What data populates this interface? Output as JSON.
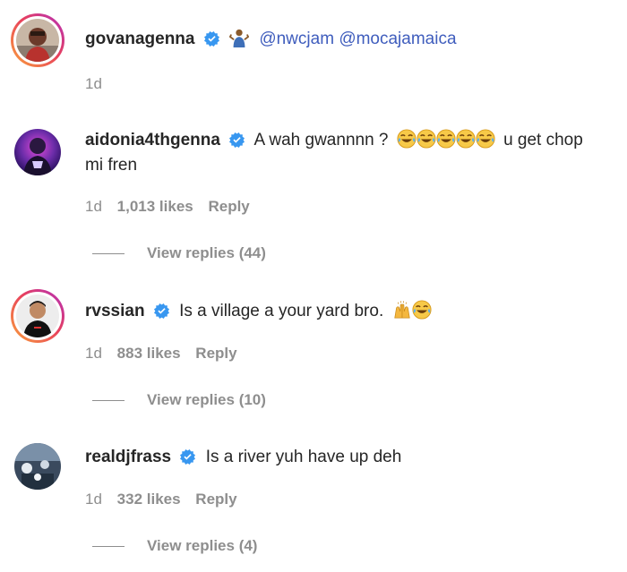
{
  "comments": [
    {
      "username": "govanagenna",
      "emoji_prefix": "person-shrugging-emoji",
      "mentions": [
        "@nwcjam",
        "@mocajamaica"
      ],
      "time": "1d"
    },
    {
      "username": "aidonia4thgenna",
      "text_before": "A wah gwannnn ?",
      "text_after": "u get chop mi fren",
      "laugh_emoji_count": 5,
      "time": "1d",
      "likes": "1,013 likes",
      "reply": "Reply",
      "view_replies": "View replies (44)"
    },
    {
      "username": "rvssian",
      "text": "Is a village a your yard bro.",
      "time": "1d",
      "likes": "883 likes",
      "reply": "Reply",
      "view_replies": "View replies (10)"
    },
    {
      "username": "realdjfrass",
      "text": "Is a river yuh have up deh",
      "time": "1d",
      "likes": "332 likes",
      "reply": "Reply",
      "view_replies": "View replies (4)"
    }
  ],
  "colors": {
    "verified": "#3897f0",
    "mention": "#3f5dbd",
    "muted": "#8e8e8e",
    "text": "#262626"
  },
  "icons": [
    "verified-badge-icon",
    "person-shrugging-emoji",
    "tears-of-joy-emoji",
    "raising-hands-emoji"
  ]
}
